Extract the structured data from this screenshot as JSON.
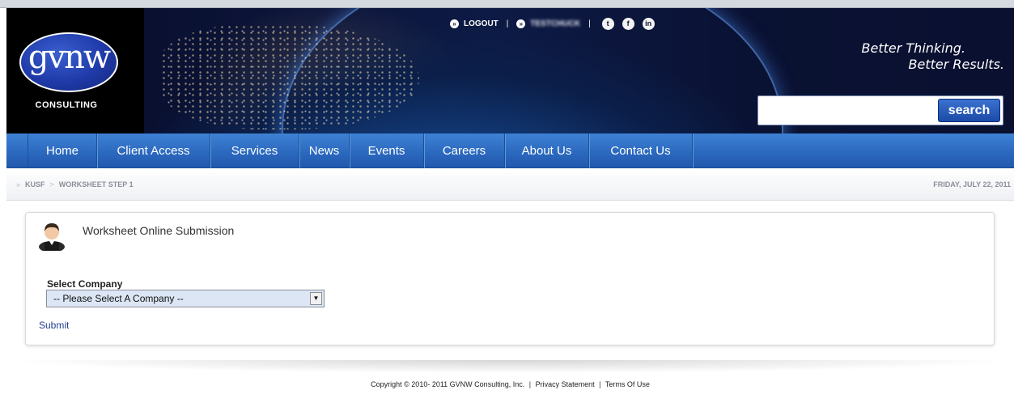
{
  "header": {
    "logo_text": "gvnw",
    "logo_subtitle": "CONSULTING",
    "logout_label": "LOGOUT",
    "username_label": "TESTCHUCK",
    "tagline_line1": "Better Thinking.",
    "tagline_line2": "Better Results.",
    "social_icons": [
      "twitter-icon",
      "facebook-icon",
      "linkedin-icon"
    ]
  },
  "search": {
    "value": "",
    "placeholder": "",
    "button_label": "search"
  },
  "nav": {
    "items": [
      "Home",
      "Client Access",
      "Services",
      "News",
      "Events",
      "Careers",
      "About Us",
      "Contact Us"
    ]
  },
  "breadcrumb": {
    "items": [
      "KUSF",
      "WORKSHEET STEP 1"
    ],
    "date": "FRIDAY, JULY 22, 2011"
  },
  "panel": {
    "title": "Worksheet Online Submission",
    "field_label": "Select Company",
    "select_value": "-- Please Select A Company --",
    "submit_label": "Submit"
  },
  "footer": {
    "copyright": "Copyright © 2010- 2011 GVNW Consulting, Inc.",
    "privacy": "Privacy Statement",
    "terms": "Terms Of Use"
  },
  "colors": {
    "nav_blue": "#2a67bd",
    "header_dark": "#0a1030",
    "link_blue": "#1f3e8f"
  }
}
